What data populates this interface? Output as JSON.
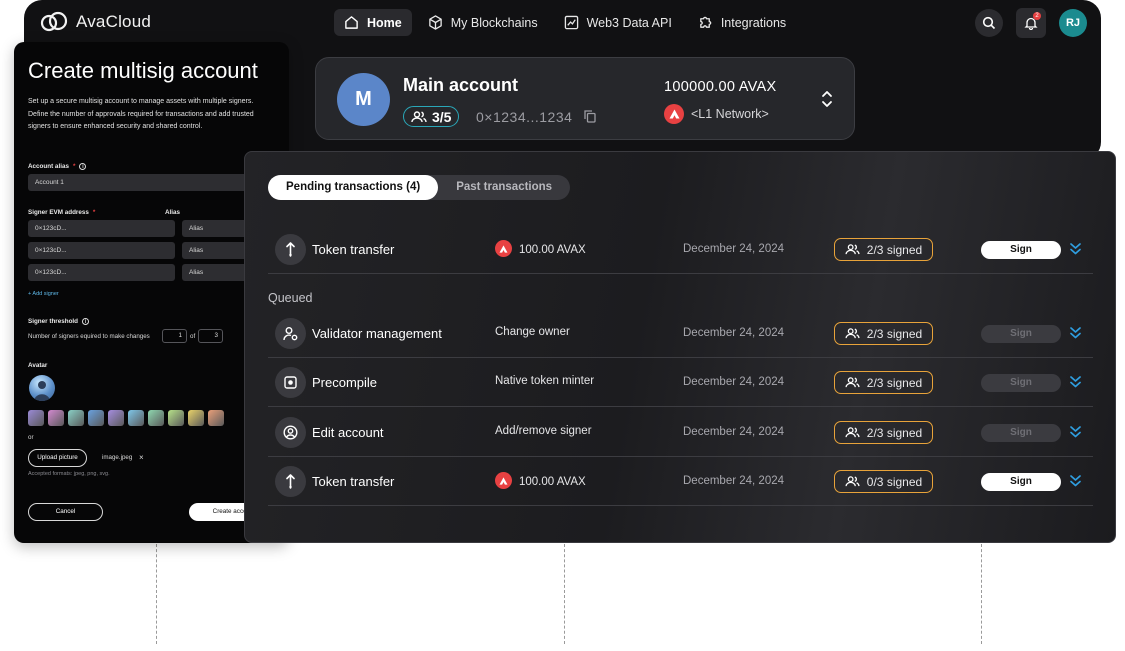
{
  "app": {
    "brand": "AvaCloud",
    "nav": [
      {
        "label": "Home",
        "icon": "home-icon",
        "active": true
      },
      {
        "label": "My Blockchains",
        "icon": "cube-icon",
        "active": false
      },
      {
        "label": "Web3 Data API",
        "icon": "chart-icon",
        "active": false
      },
      {
        "label": "Integrations",
        "icon": "puzzle-icon",
        "active": false
      }
    ],
    "user_initials": "RJ",
    "notification_count": "2"
  },
  "account": {
    "avatar_letter": "M",
    "name": "Main account",
    "signers": "3/5",
    "address": "0×1234...1234",
    "balance": "100000.00 AVAX",
    "network": "<L1 Network>"
  },
  "create": {
    "title": "Create multisig account",
    "description": "Set up a secure multisig account to manage assets with multiple signers. Define the number of approvals required for transactions and add trusted signers to ensure enhanced security and shared control.",
    "alias_label": "Account alias",
    "alias_value": "Account 1",
    "signer_label": "Signer EVM address",
    "alias_col_label": "Alias",
    "signers": [
      {
        "address": "0×123cD...",
        "alias": "Alias"
      },
      {
        "address": "0×123cD...",
        "alias": "Alias"
      },
      {
        "address": "0×123cD...",
        "alias": "Alias"
      }
    ],
    "add_signer": "+ Add signer",
    "threshold_label": "Signer threshold",
    "threshold_text": "Number of signers equired to make changes",
    "threshold_value": "1",
    "threshold_of": "of",
    "threshold_total": "3",
    "avatar_label": "Avatar",
    "swatch_colors": [
      "#9b8ad6",
      "#d38ad0",
      "#8ad0c6",
      "#6aa2e0",
      "#a68ee0",
      "#7fc7ea",
      "#8fd8b0",
      "#b8e28a",
      "#ead36a",
      "#eaa07a"
    ],
    "or_text": "or",
    "upload_label": "Upload picture",
    "file_name": "image.jpeg",
    "file_remove": "×",
    "formats_text": "Accepted formats: jpeg, png, svg.",
    "cancel_label": "Cancel",
    "submit_label": "Create account"
  },
  "transactions": {
    "tabs": [
      {
        "label": "Pending transactions (4)",
        "active": true
      },
      {
        "label": "Past transactions",
        "active": false
      }
    ],
    "queued_label": "Queued",
    "rows": [
      {
        "title": "Token transfer",
        "icon": "arrow-up-down-icon",
        "detail": "100.00 AVAX",
        "avax": true,
        "date": "December 24, 2024",
        "signed": "2/3 signed",
        "sign_label": "Sign",
        "sign_enabled": true
      },
      {
        "title": "Validator management",
        "icon": "user-gear-icon",
        "detail": "Change owner",
        "avax": false,
        "date": "December 24, 2024",
        "signed": "2/3 signed",
        "sign_label": "Sign",
        "sign_enabled": false
      },
      {
        "title": "Precompile",
        "icon": "chip-icon",
        "detail": "Native token minter",
        "avax": false,
        "date": "December 24, 2024",
        "signed": "2/3 signed",
        "sign_label": "Sign",
        "sign_enabled": false
      },
      {
        "title": "Edit account",
        "icon": "user-circle-icon",
        "detail": "Add/remove signer",
        "avax": false,
        "date": "December 24, 2024",
        "signed": "2/3 signed",
        "sign_label": "Sign",
        "sign_enabled": false
      },
      {
        "title": "Token transfer",
        "icon": "arrow-up-down-icon",
        "detail": "100.00 AVAX",
        "avax": true,
        "date": "December 24, 2024",
        "signed": "0/3 signed",
        "sign_label": "Sign",
        "sign_enabled": true
      }
    ]
  }
}
